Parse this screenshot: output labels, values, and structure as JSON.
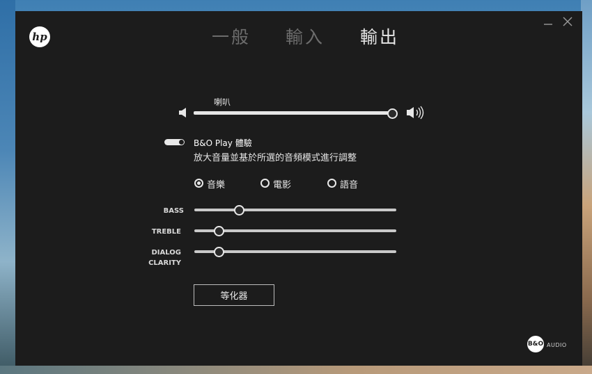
{
  "header": {
    "brand_logo": "hp",
    "tabs": [
      {
        "label": "一般",
        "active": false
      },
      {
        "label": "輸入",
        "active": false
      },
      {
        "label": "輸出",
        "active": true
      }
    ],
    "minimize_icon": "minimize-icon",
    "close_icon": "close-icon"
  },
  "output": {
    "speaker_label": "喇叭",
    "volume_level": 1.0,
    "bo_play": {
      "title": "B&O Play 體驗",
      "description": "放大音量並基於所選的音頻模式進行調整",
      "enabled": true
    },
    "modes": [
      {
        "label": "音樂",
        "selected": true
      },
      {
        "label": "電影",
        "selected": false
      },
      {
        "label": "語音",
        "selected": false
      }
    ],
    "sliders": {
      "bass": {
        "label": "BASS",
        "value": 0.22
      },
      "treble": {
        "label": "TREBLE",
        "value": 0.12
      },
      "dialog_clarity": {
        "label_line1": "DIALOG",
        "label_line2": "CLARITY",
        "value": 0.12
      }
    },
    "equalizer_button": "等化器"
  },
  "footer": {
    "bo_logo": "B&O",
    "audio_label": "AUDIO"
  },
  "colors": {
    "window_bg": "#1c1c1c",
    "active_tab": "#e6e6e6",
    "inactive_tab": "#6d6d6d"
  }
}
